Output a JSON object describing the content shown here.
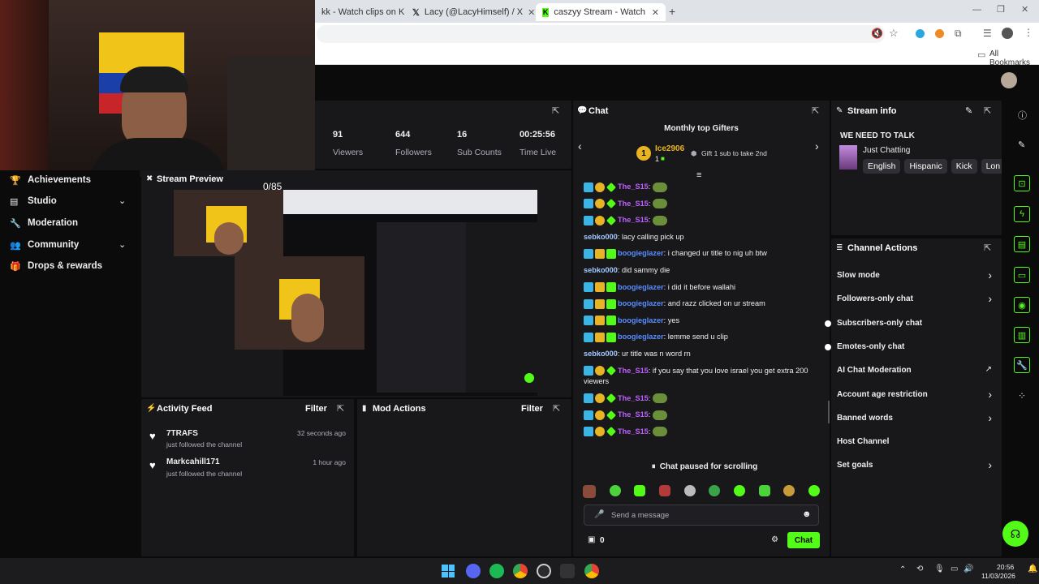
{
  "browser": {
    "tabs": [
      {
        "label": "kk - Watch clips on Kick"
      },
      {
        "label": "Lacy (@LacyHimself) / X"
      },
      {
        "label": "caszyy Stream - Watch Live on"
      }
    ],
    "bookmarks_label": "All Bookmarks"
  },
  "stats": [
    {
      "value": "91",
      "label": "Viewers"
    },
    {
      "value": "644",
      "label": "Followers"
    },
    {
      "value": "16",
      "label": "Sub Counts"
    },
    {
      "value": "00:25:56",
      "label": "Time Live"
    }
  ],
  "sidebar": {
    "items": [
      {
        "label": "Achievements",
        "icon": "trophy-icon",
        "expandable": false
      },
      {
        "label": "Studio",
        "icon": "studio-icon",
        "expandable": true
      },
      {
        "label": "Moderation",
        "icon": "wrench-icon",
        "expandable": false
      },
      {
        "label": "Community",
        "icon": "community-icon",
        "expandable": true
      },
      {
        "label": "Drops & rewards",
        "icon": "gift-icon",
        "expandable": false
      }
    ]
  },
  "preview": {
    "title": "Stream Preview",
    "counter": "0/85"
  },
  "activity": {
    "title": "Activity Feed",
    "filter": "Filter",
    "items": [
      {
        "name": "7TRAFS",
        "text": "just followed the channel",
        "time": "32 seconds ago"
      },
      {
        "name": "Markcahill171",
        "text": "just followed the channel",
        "time": "1 hour ago"
      }
    ]
  },
  "mod_actions": {
    "title": "Mod Actions",
    "filter": "Filter"
  },
  "chat": {
    "title": "Chat",
    "gifters_title": "Monthly top Gifters",
    "gifter_rank": "1",
    "gifter_name": "Ice2906",
    "gifter_count": "1",
    "gift_prompt": "Gift 1 sub to take 2nd",
    "messages": [
      {
        "user": "The_S15",
        "sep": ":",
        "text": "",
        "color": "#bf5fff",
        "badges": "sub",
        "emote": true
      },
      {
        "user": "The_S15",
        "sep": ":",
        "text": "",
        "color": "#bf5fff",
        "badges": "sub",
        "emote": true
      },
      {
        "user": "The_S15",
        "sep": ":",
        "text": "",
        "color": "#bf5fff",
        "badges": "sub",
        "emote": true
      },
      {
        "user": "sebko000",
        "sep": ":",
        "text": "lacy calling pick up",
        "color": "#a2c8ff",
        "badges": "none",
        "emote": false
      },
      {
        "user": "boogieglazer",
        "sep": ":",
        "text": "i changed ur title to nig uh btw",
        "color": "#5a8dff",
        "badges": "mod",
        "emote": false
      },
      {
        "user": "sebko000",
        "sep": ":",
        "text": "did sammy die",
        "color": "#a2c8ff",
        "badges": "none",
        "emote": false
      },
      {
        "user": "boogieglazer",
        "sep": ":",
        "text": "i did it before wallahi",
        "color": "#5a8dff",
        "badges": "mod",
        "emote": false
      },
      {
        "user": "boogieglazer",
        "sep": ":",
        "text": "and razz clicked on ur stream",
        "color": "#5a8dff",
        "badges": "mod",
        "emote": false
      },
      {
        "user": "boogieglazer",
        "sep": ":",
        "text": "yes",
        "color": "#5a8dff",
        "badges": "mod",
        "emote": false
      },
      {
        "user": "boogieglazer",
        "sep": ":",
        "text": "lemme send u clip",
        "color": "#5a8dff",
        "badges": "mod",
        "emote": false
      },
      {
        "user": "sebko000",
        "sep": ":",
        "text": "ur title was n word rn",
        "color": "#a2c8ff",
        "badges": "none",
        "emote": false
      },
      {
        "user": "The_S15",
        "sep": ":",
        "text": "if you say that you love israel you get extra 200 viewers",
        "color": "#bf5fff",
        "badges": "sub",
        "emote": false
      },
      {
        "user": "The_S15",
        "sep": ":",
        "text": "",
        "color": "#bf5fff",
        "badges": "sub",
        "emote": true
      },
      {
        "user": "The_S15",
        "sep": ":",
        "text": "",
        "color": "#bf5fff",
        "badges": "sub",
        "emote": true
      },
      {
        "user": "The_S15",
        "sep": ":",
        "text": "",
        "color": "#bf5fff",
        "badges": "sub",
        "emote": true
      }
    ],
    "paused": "Chat paused for scrolling",
    "placeholder": "Send a message",
    "points": "0",
    "send": "Chat"
  },
  "stream_info": {
    "title": "Stream info",
    "stream_title": "WE NEED TO TALK",
    "category": "Just Chatting",
    "tags": [
      "English",
      "Hispanic",
      "Kick",
      "Lon"
    ]
  },
  "channel_actions": {
    "title": "Channel Actions",
    "items": [
      {
        "label": "Slow mode",
        "control": "chevron"
      },
      {
        "label": "Followers-only chat",
        "control": "chevron"
      },
      {
        "label": "Subscribers-only chat",
        "control": "toggle"
      },
      {
        "label": "Emotes-only chat",
        "control": "toggle"
      },
      {
        "label": "AI Chat Moderation",
        "control": "external"
      },
      {
        "label": "Account age restriction",
        "control": "chevron"
      },
      {
        "label": "Banned words",
        "control": "chevron"
      },
      {
        "label": "Host Channel",
        "control": "none"
      },
      {
        "label": "Set goals",
        "control": "chevron"
      }
    ]
  },
  "taskbar": {
    "time": "20:56",
    "date": "11/03/2026"
  },
  "colors": {
    "accent": "#53fc18",
    "panel": "#18181b",
    "background": "#0b0b0c"
  }
}
